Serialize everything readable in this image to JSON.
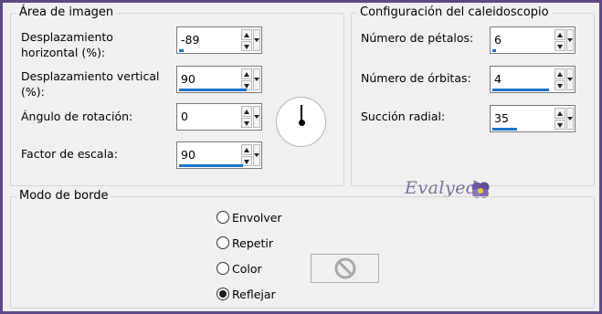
{
  "colors": {
    "accent_bar": "#1a74cc",
    "frame": "#5b4a86",
    "panel": "#f0f0f0"
  },
  "image_area": {
    "title": "Área de imagen",
    "fields": [
      {
        "label_a": "Desplazamiento",
        "label_b": "horizontal (%):",
        "value": "-89",
        "fill": 0.06
      },
      {
        "label_a": "Desplazamiento vertical",
        "label_b": "(%):",
        "value": "90",
        "fill": 0.95
      },
      {
        "label_a": "Ángulo de rotación:",
        "value": "0",
        "fill": 0
      },
      {
        "label_a": "Factor de escala:",
        "value": "90",
        "fill": 0.9
      }
    ],
    "dial_icon": "rotation-dial-icon"
  },
  "kaleidoscope": {
    "title": "Configuración del caleidoscopio",
    "fields": [
      {
        "label": "Número de pétalos:",
        "value": "6",
        "fill": 0.05
      },
      {
        "label": "Número de órbitas:",
        "value": "4",
        "fill": 0.8
      },
      {
        "label": "Succión radial:",
        "value": "35",
        "fill": 0.35
      }
    ]
  },
  "watermark": {
    "text": "Evalyeda",
    "icon": "pansy-flower-icon"
  },
  "border_mode": {
    "title": "Modo de borde",
    "options": [
      {
        "label": "Envolver",
        "selected": false
      },
      {
        "label": "Repetir",
        "selected": false
      },
      {
        "label": "Color",
        "selected": false
      },
      {
        "label": "Reflejar",
        "selected": true
      }
    ],
    "color_swatch_icon": "disabled-no-icon"
  }
}
